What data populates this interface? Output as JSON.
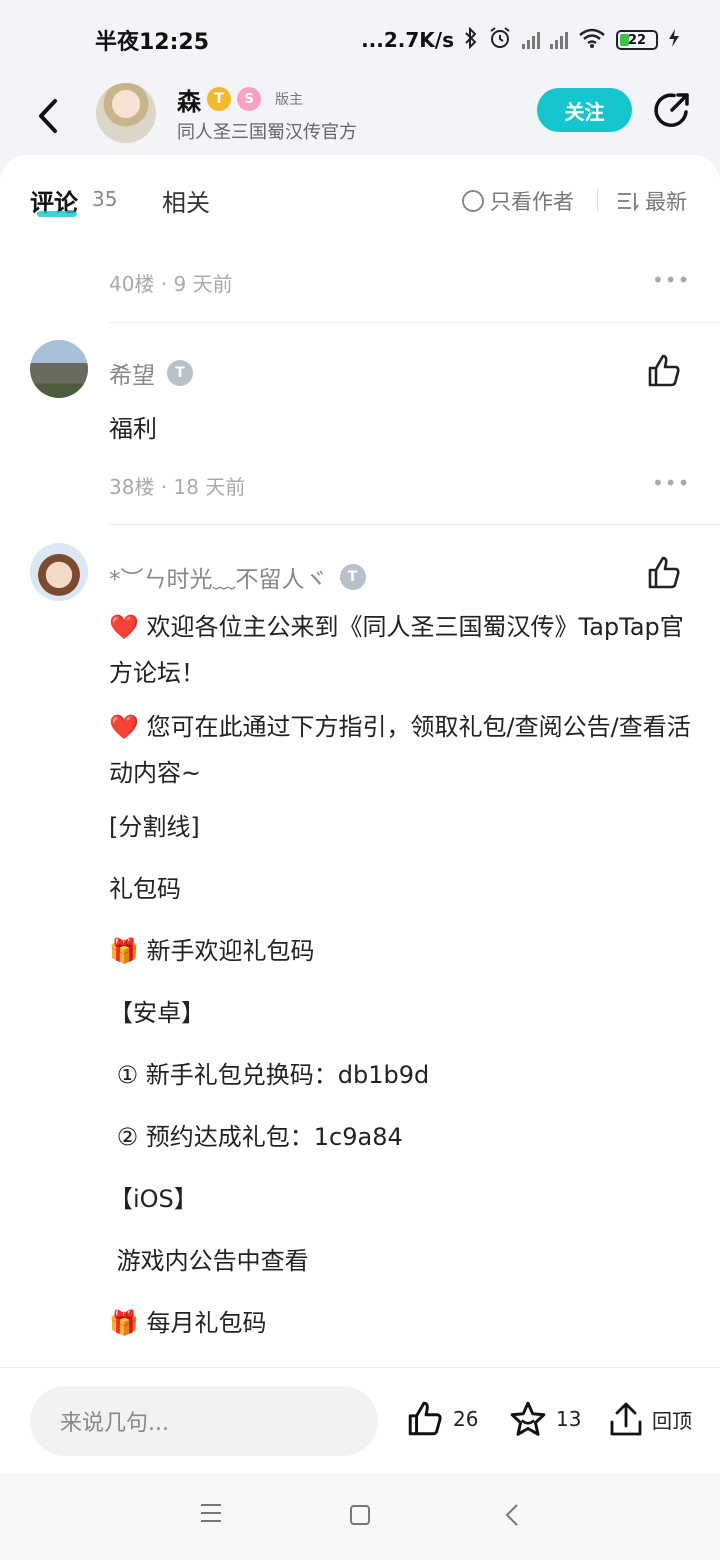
{
  "status_bar": {
    "time": "半夜12:25",
    "speed": "...2.7K/s",
    "battery": "22"
  },
  "header": {
    "author_name": "森",
    "badge_t": "T",
    "badge_pink": "S",
    "moderator_label": "版主",
    "subtitle": "同人圣三国蜀汉传官方",
    "follow_label": "关注"
  },
  "tabs": {
    "comment_label": "评论",
    "comment_count": "35",
    "related_label": "相关",
    "only_author_label": "只看作者",
    "sort_label": "最新"
  },
  "floor40": {
    "meta": "40楼 · 9 天前",
    "more": "•••"
  },
  "comment_hope": {
    "name": "希望",
    "level_badge": "T",
    "text": "福利",
    "meta": "38楼 · 18 天前",
    "more": "•••"
  },
  "comment_time": {
    "name": "*︶ㄣ时光﹏不留人ヾ",
    "level_badge": "T"
  },
  "post_body": {
    "heart": "❤️",
    "gift": "🎁",
    "line1": "欢迎各位主公来到《同人圣三国蜀汉传》TapTap官方论坛！",
    "line2": "您可在此通过下方指引，领取礼包/查阅公告/查看活动内容~",
    "line3": "[分割线]",
    "line4": "礼包码",
    "line5": "新手欢迎礼包码",
    "line6": "【安卓】",
    "line7": " ① 新手礼包兑换码：db1b9d",
    "line8": " ② 预约达成礼包：1c9a84",
    "line9": "【iOS】",
    "line10": " 游戏内公告中查看",
    "line11": "每月礼包码"
  },
  "bottom_bar": {
    "input_placeholder": "来说几句...",
    "like_count": "26",
    "favorite_count": "13",
    "top_label": "回顶"
  },
  "colors": {
    "accent": "#15c5ce",
    "heart": "#d6202a"
  }
}
